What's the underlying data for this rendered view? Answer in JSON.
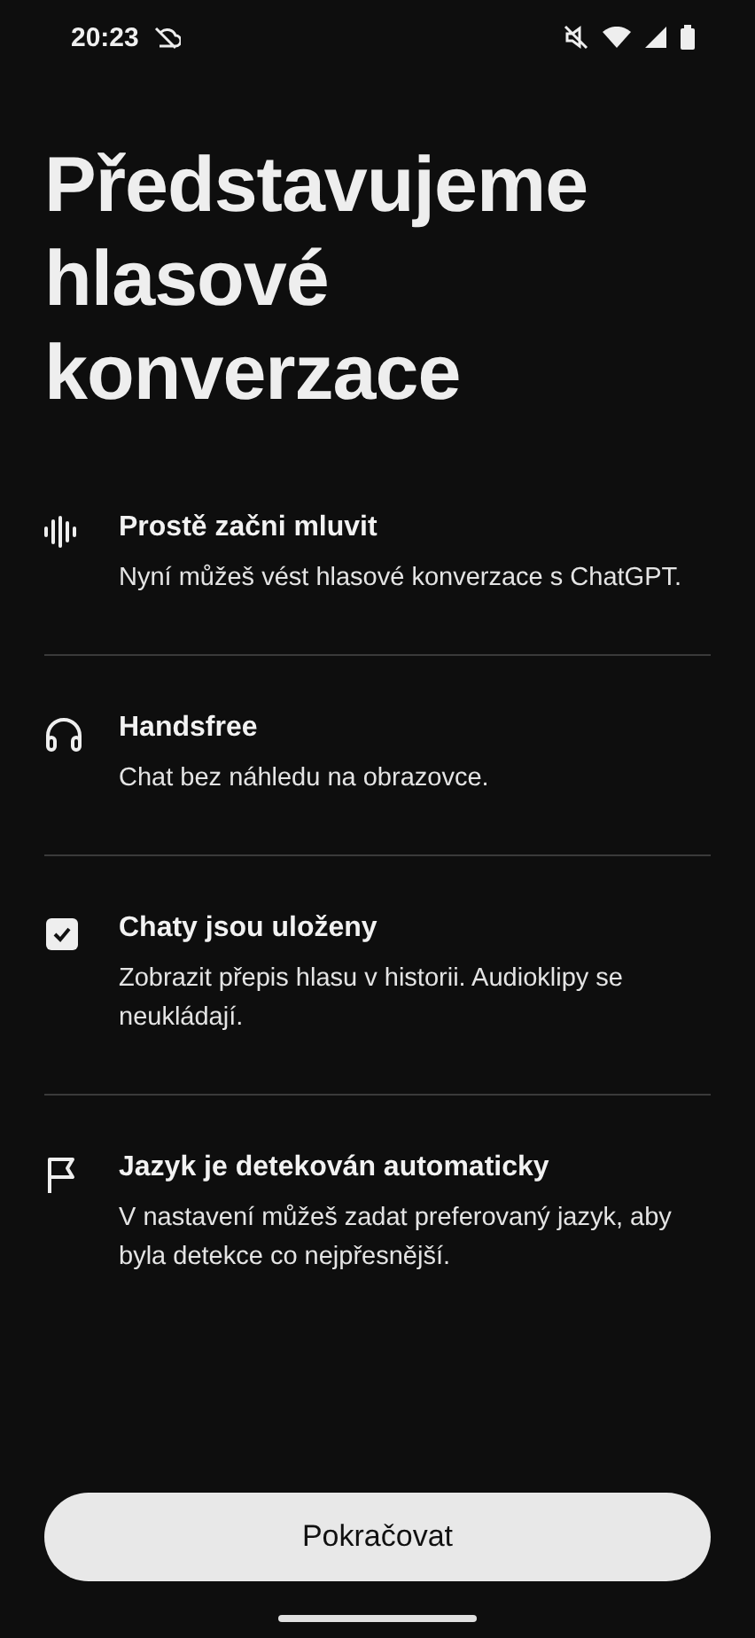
{
  "status_bar": {
    "time": "20:23"
  },
  "title": "Představujeme hlasové konverzace",
  "features": [
    {
      "kind": "waveform",
      "title": "Prostě začni mluvit",
      "text": "Nyní můžeš vést hlasové konverzace s ChatGPT."
    },
    {
      "kind": "headphones",
      "title": "Handsfree",
      "text": "Chat bez náhledu na obrazovce."
    },
    {
      "kind": "checkbox",
      "title": "Chaty jsou uloženy",
      "text": "Zobrazit přepis hlasu v historii. Audioklipy se neukládají."
    },
    {
      "kind": "flag",
      "title": "Jazyk je detekován automaticky",
      "text": "V nastavení můžeš zadat preferovaný jazyk, aby byla detekce co nejpřesnější."
    }
  ],
  "continue_button": "Pokračovat"
}
